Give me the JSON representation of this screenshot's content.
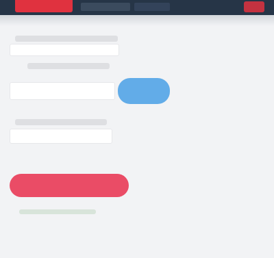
{
  "header": {
    "brand": "",
    "nav": [
      "",
      ""
    ],
    "user": ""
  },
  "form": {
    "field_labels": [
      "",
      "",
      ""
    ],
    "values": [
      "",
      "",
      ""
    ],
    "primary_button_label": "",
    "danger_button_label": "",
    "footer_link": ""
  },
  "colors": {
    "topbar": "#263547",
    "brand": "#e0323f",
    "primary_button": "#62ace8",
    "danger_button": "#ea4c66"
  }
}
